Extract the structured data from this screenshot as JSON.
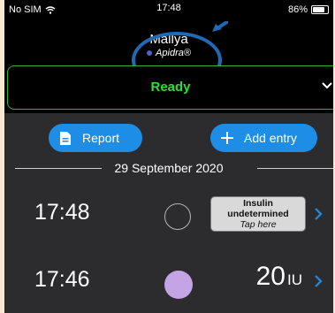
{
  "status_bar": {
    "carrier": "No SIM",
    "time": "17:48",
    "battery": "86%"
  },
  "header": {
    "profile_name": "Mallya",
    "drug": "Apidra®"
  },
  "ready_bar": {
    "label": "Ready"
  },
  "actions": {
    "report_label": "Report",
    "add_entry_label": "Add entry"
  },
  "date_header": "29 September 2020",
  "entries": [
    {
      "time": "17:48",
      "insulin_line1": "Insulin",
      "insulin_line2": "undetermined",
      "insulin_hint": "Tap here"
    },
    {
      "time": "17:46",
      "dose": "20",
      "unit": "IU"
    }
  ],
  "colors": {
    "accent_blue": "#1e8de6",
    "ready_green": "#2ddf35",
    "dose_purple": "#c5a4e6",
    "drug_dot": "#4b63c8"
  }
}
